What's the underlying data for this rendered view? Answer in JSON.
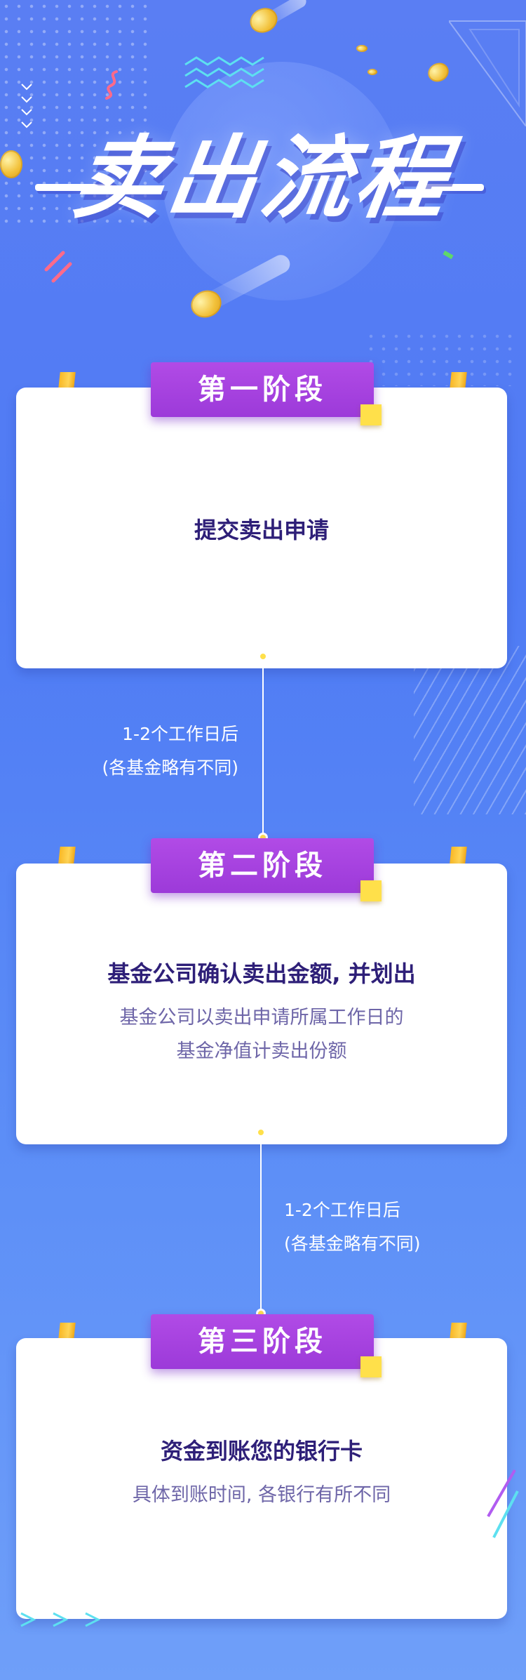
{
  "header": {
    "title": "卖出流程"
  },
  "stages": [
    {
      "label": "第一阶段",
      "title": "提交卖出申请"
    },
    {
      "label": "第二阶段",
      "title": "基金公司确认卖出金额, 并划出",
      "desc_line1": "基金公司以卖出申请所属工作日的",
      "desc_line2": "基金净值计卖出份额"
    },
    {
      "label": "第三阶段",
      "title": "资金到账您的银行卡",
      "desc_line1": "具体到账时间, 各银行有所不同"
    }
  ],
  "connectors": [
    {
      "line1": "1-2个工作日后",
      "line2": "(各基金略有不同)"
    },
    {
      "line1": "1-2个工作日后",
      "line2": "(各基金略有不同)"
    }
  ],
  "colors": {
    "background": "#5a7ef3",
    "label": "#a142e0",
    "accent": "#ffe04a",
    "title_text": "#2e1f78"
  }
}
